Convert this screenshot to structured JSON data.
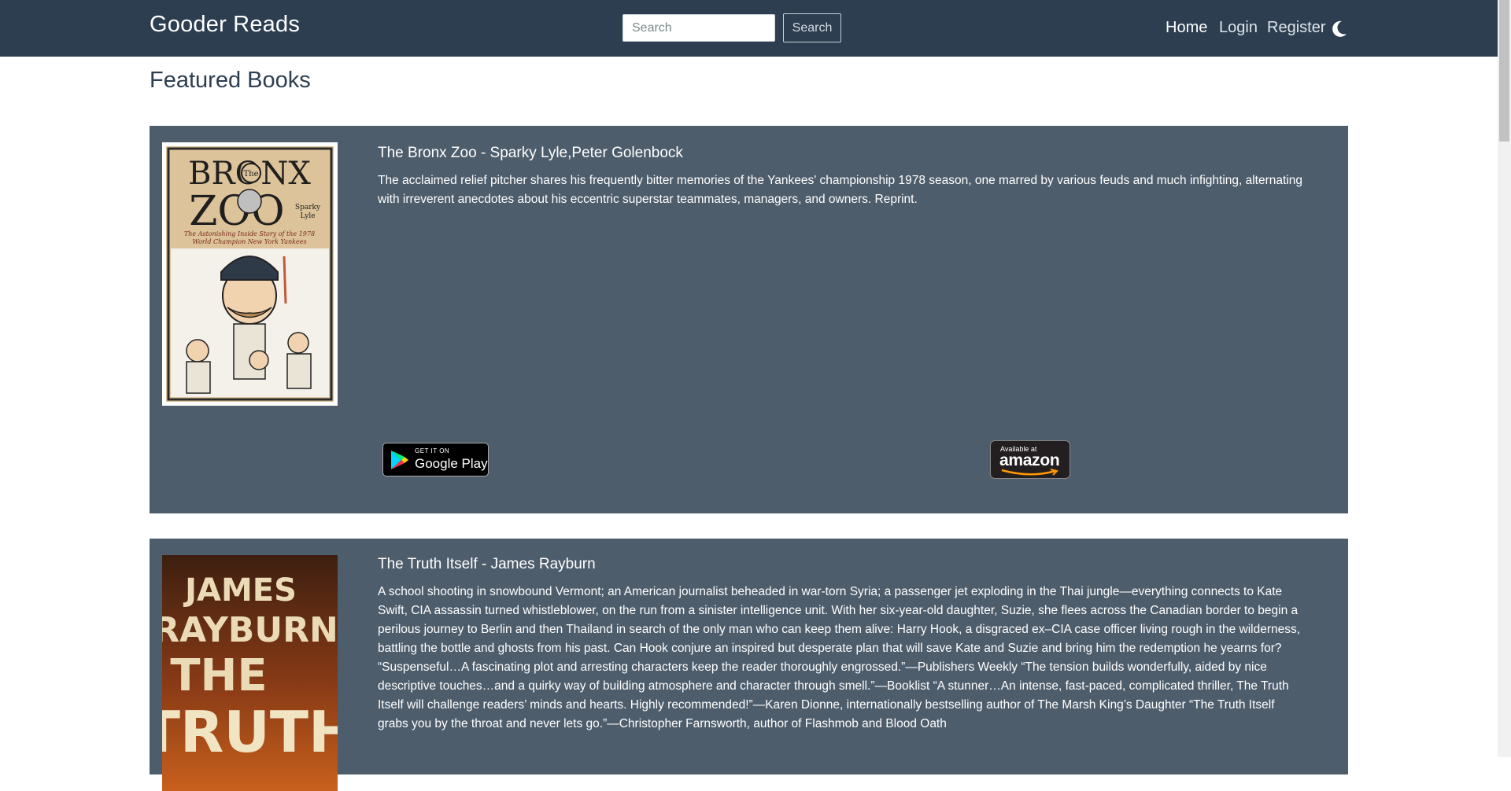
{
  "navbar": {
    "brand": "Gooder Reads",
    "search_placeholder": "Search",
    "search_button": "Search",
    "links": [
      "Home",
      "Login",
      "Register"
    ],
    "theme_toggle_icon": "moon-icon"
  },
  "page": {
    "title": "Featured Books"
  },
  "books": [
    {
      "title": "The Bronx Zoo - Sparky Lyle,Peter Golenbock",
      "description": "The acclaimed relief pitcher shares his frequently bitter memories of the Yankees' championship 1978 season, one marred by various feuds and much infighting, alternating with irreverent anecdotes about his eccentric superstar teammates, managers, and owners. Reprint.",
      "cover_text": [
        "BRONX",
        "The",
        "ZOO",
        "Sparky",
        "Lyle",
        "The Astonishing Inside Story of the 1978",
        "World Champion New York Yankees"
      ],
      "google_play": {
        "top": "GET IT ON",
        "name": "Google Play"
      },
      "amazon": {
        "top": "Available at",
        "name": "amazon"
      }
    },
    {
      "title": "The Truth Itself - James Rayburn",
      "description": "A school shooting in snowbound Vermont; an American journalist beheaded in war-torn Syria; a passenger jet exploding in the Thai jungle—everything connects to Kate Swift, CIA assassin turned whistleblower, on the run from a sinister intelligence unit. With her six-year-old daughter, Suzie, she flees across the Canadian border to begin a perilous journey to Berlin and then Thailand in search of the only man who can keep them alive: Harry Hook, a disgraced ex–CIA case officer living rough in the wilderness, battling the bottle and ghosts from his past. Can Hook conjure an inspired but desperate plan that will save Kate and Suzie and bring him the redemption he yearns for? “Suspenseful…A fascinating plot and arresting characters keep the reader thoroughly engrossed.”—Publishers Weekly “The tension builds wonderfully, aided by nice descriptive touches…and a quirky way of building atmosphere and character through smell.”—Booklist “A stunner…An intense, fast-paced, complicated thriller, The Truth Itself will challenge readers’ minds and hearts. Highly recommended!”—Karen Dionne, internationally bestselling author of The Marsh King’s Daughter “The Truth Itself grabs you by the throat and never lets go.”—Christopher Farnsworth, author of Flashmob and Blood Oath",
      "cover_text": [
        "JAMES",
        "RAYBURN",
        "THE",
        "TRUTH"
      ]
    }
  ],
  "colors": {
    "navbar": "#2c3e50",
    "card": "#4e5d6c",
    "title_text": "#2c3e50"
  }
}
